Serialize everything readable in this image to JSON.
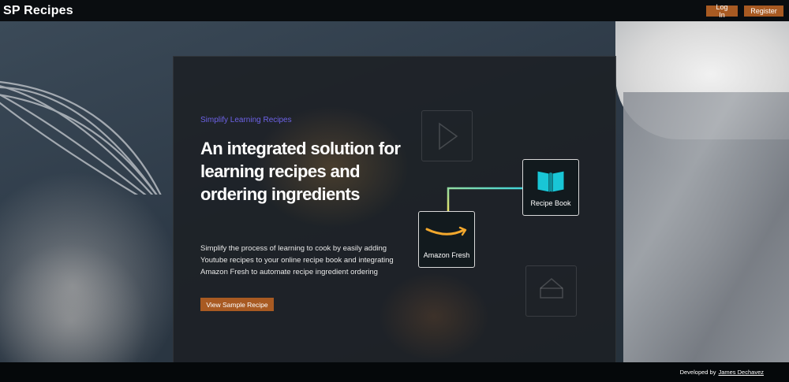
{
  "nav": {
    "brand": "SP Recipes",
    "login_label": "Log In",
    "register_label": "Register"
  },
  "hero": {
    "eyebrow": "Simplify Learning Recipes",
    "headline": "An integrated solution for learning recipes and ordering ingredients",
    "description": "Simplify the process of learning to cook by easily adding Youtube recipes to your online recipe book and integrating Amazon Fresh to automate recipe ingredient ordering",
    "cta_label": "View Sample Recipe"
  },
  "diagram": {
    "amazon_label": "Amazon Fresh",
    "book_label": "Recipe Book",
    "icons": [
      "play-icon",
      "amazon-smile-icon",
      "open-book-icon",
      "house-icon"
    ]
  },
  "footer": {
    "prefix": "Developed by",
    "author": "James Dechavez"
  },
  "colors": {
    "accent": "#a85a22",
    "eyebrow": "#6d62e6",
    "book_icon": "#19c6d6",
    "amazon_smile": "#f3a82d",
    "connector_start": "#e7e36a",
    "connector_end": "#3fd4d8"
  }
}
